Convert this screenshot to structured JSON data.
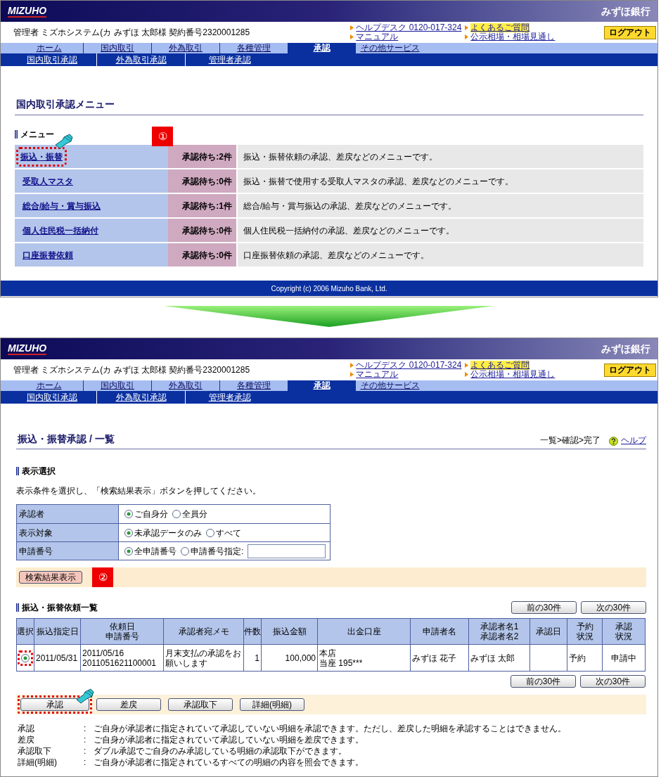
{
  "screens": [
    {
      "kind": "menu",
      "header": {
        "logo": "MIZUHO",
        "bank_name": "みずほ銀行",
        "user": "管理者 ミズホシステム(カ みずほ 太郎様 契約番号2320001285",
        "link_groups": [
          {
            "links": [
              {
                "text": "ヘルプデスク 0120-017-324",
                "highlighted": false
              },
              {
                "text": "マニュアル",
                "highlighted": false
              }
            ]
          },
          {
            "links": [
              {
                "text": "よくあるご質問",
                "highlighted": true
              },
              {
                "text": "公示相場・相場見通し",
                "highlighted": false
              }
            ]
          }
        ],
        "logout": "ログアウト",
        "tabs": [
          {
            "label": "ホーム",
            "selected": false
          },
          {
            "label": "国内取引",
            "selected": false
          },
          {
            "label": "外為取引",
            "selected": false
          },
          {
            "label": "各種管理",
            "selected": false
          },
          {
            "label": "承認",
            "selected": true
          },
          {
            "label": "その他サービス",
            "selected": false
          }
        ],
        "subtabs": [
          "国内取引承認",
          "外為取引承認",
          "管理者承認"
        ]
      },
      "title": "国内取引承認メニュー",
      "section": "メニュー",
      "callout": "①",
      "menu": [
        {
          "label": "振込・振替",
          "pending": "承認待ち:2件",
          "description": "振込・振替依頼の承認、差戻などのメニューです。",
          "pointer": true
        },
        {
          "label": "受取人マスタ",
          "pending": "承認待ち:0件",
          "description": "振込・振替で使用する受取人マスタの承認、差戻などのメニューです。",
          "pointer": false
        },
        {
          "label": "総合/給与・賞与振込",
          "pending": "承認待ち:1件",
          "description": "総合/給与・賞与振込の承認、差戻などのメニューです。",
          "pointer": false
        },
        {
          "label": "個人住民税一括納付",
          "pending": "承認待ち:0件",
          "description": "個人住民税一括納付の承認、差戻などのメニューです。",
          "pointer": false
        },
        {
          "label": "口座振替依頼",
          "pending": "承認待ち:0件",
          "description": "口座振替依頼の承認、差戻などのメニューです。",
          "pointer": false
        }
      ],
      "footer": "Copyright (c) 2006 Mizuho Bank, Ltd."
    },
    {
      "kind": "list",
      "header": {
        "logo": "MIZUHO",
        "bank_name": "みずほ銀行",
        "user": "管理者 ミズホシステム(カ みずほ 太郎様 契約番号2320001285",
        "link_groups": [
          {
            "links": [
              {
                "text": "ヘルプデスク 0120-017-324",
                "highlighted": false
              },
              {
                "text": "マニュアル",
                "highlighted": false
              }
            ]
          },
          {
            "links": [
              {
                "text": "よくあるご質問",
                "highlighted": true
              },
              {
                "text": "公示相場・相場見通し",
                "highlighted": false
              }
            ]
          }
        ],
        "logout": "ログアウト",
        "tabs": [
          {
            "label": "ホーム",
            "selected": false
          },
          {
            "label": "国内取引",
            "selected": false
          },
          {
            "label": "外為取引",
            "selected": false
          },
          {
            "label": "各種管理",
            "selected": false
          },
          {
            "label": "承認",
            "selected": true
          },
          {
            "label": "その他サービス",
            "selected": false
          }
        ],
        "subtabs": [
          "国内取引承認",
          "外為取引承認",
          "管理者承認"
        ]
      },
      "title": "振込・振替承認 / 一覧",
      "steps": "一覧>確認>完了",
      "help": "ヘルプ",
      "filter": {
        "heading": "表示選択",
        "instruction": "表示条件を選択し、「検索結果表示」ボタンを押してください。",
        "rows": [
          {
            "label": "承認者",
            "options": [
              {
                "label": "ご自身分",
                "selected": true
              },
              {
                "label": "全員分",
                "selected": false
              }
            ],
            "text_input": false
          },
          {
            "label": "表示対象",
            "options": [
              {
                "label": "未承認データのみ",
                "selected": true
              },
              {
                "label": "すべて",
                "selected": false
              }
            ],
            "text_input": false
          },
          {
            "label": "申請番号",
            "options": [
              {
                "label": "全申請番号",
                "selected": true
              },
              {
                "label": "申請番号指定:",
                "selected": false
              }
            ],
            "text_input": true
          }
        ],
        "button": "検索結果表示",
        "callout": "②"
      },
      "list": {
        "heading": "振込・振替依頼一覧",
        "pager": [
          "前の30件",
          "次の30件"
        ],
        "columns": [
          "選択",
          "振込指定日",
          [
            "依頼日",
            "申請番号"
          ],
          "承認者宛メモ",
          "件数",
          "振込金額",
          "出金口座",
          "申請者名",
          [
            "承認者名1",
            "承認者名2"
          ],
          "承認日",
          "予約状況",
          "承認状況"
        ],
        "rows": [
          {
            "selected": true,
            "highlighted": true,
            "cells": [
              "",
              "2011/05/31",
              [
                "2011/05/16",
                "2011051621100001"
              ],
              "月末支払の承認をお願いします",
              "1",
              "100,000",
              [
                "本店",
                "当座 195***"
              ],
              "みずほ 花子",
              "みずほ 太郎",
              null,
              "予約",
              "申請中"
            ]
          }
        ],
        "pager_bottom": [
          "前の30件",
          "次の30件"
        ]
      },
      "actions": [
        {
          "label": "承認",
          "pointer": true
        },
        {
          "label": "差戻",
          "pointer": false
        },
        {
          "label": "承認取下",
          "pointer": false
        },
        {
          "label": "詳細(明細)",
          "pointer": false
        }
      ],
      "notes": [
        {
          "term": "承認",
          "separator": ":",
          "text": "ご自身が承認者に指定されていて承認していない明細を承認できます。ただし、差戻した明細を承認することはできません。"
        },
        {
          "term": "差戻",
          "separator": ":",
          "text": "ご自身が承認者に指定されていて承認していない明細を差戻できます。"
        },
        {
          "term": "承認取下",
          "separator": ":",
          "text": "ダブル承認でご自身のみ承認している明細の承認取下ができます。"
        },
        {
          "term": "詳細(明細)",
          "separator": ":",
          "text": "ご自身が承認者に指定されているすべての明細の内容を照会できます。"
        }
      ]
    }
  ]
}
